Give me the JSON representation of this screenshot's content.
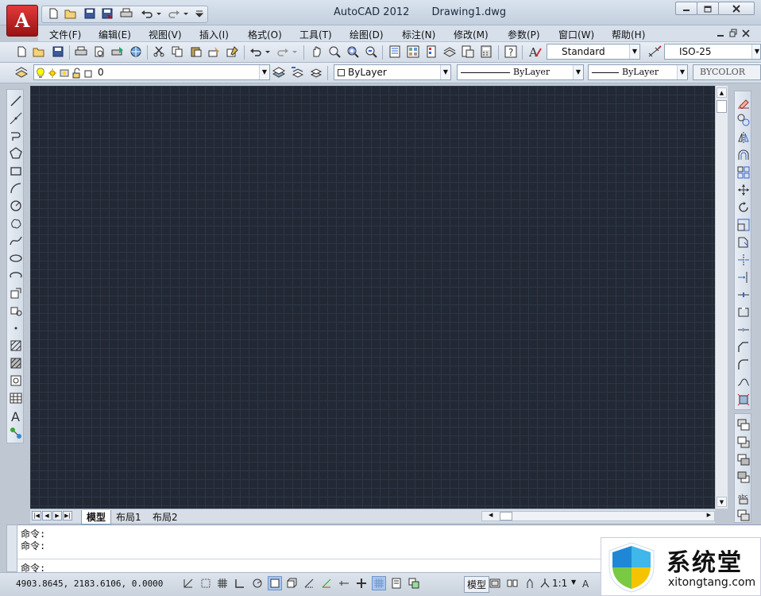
{
  "window": {
    "app_title": "AutoCAD 2012",
    "doc_title": "Drawing1.dwg",
    "app_button_letter": "A",
    "minimize_icon": "minimize-icon",
    "restore_icon": "restore-icon",
    "close_icon": "close-icon"
  },
  "menu": [
    "文件(F)",
    "编辑(E)",
    "视图(V)",
    "插入(I)",
    "格式(O)",
    "工具(T)",
    "绘图(D)",
    "标注(N)",
    "修改(M)",
    "参数(P)",
    "窗口(W)",
    "帮助(H)"
  ],
  "styles": {
    "text_style": "Standard",
    "dim_style": "ISO-25"
  },
  "layers": {
    "current_layer": "0",
    "color": "ByLayer",
    "linetype": "ByLayer",
    "lineweight": "ByLayer",
    "plotstyle": "BYCOLOR"
  },
  "tabs": {
    "model": "模型",
    "layout1": "布局1",
    "layout2": "布局2"
  },
  "command": {
    "line1": "命令:",
    "line2": "命令:",
    "prompt": "命令:"
  },
  "status": {
    "coords": "4903.8645, 2183.6106, 0.0000",
    "model_label": "模型",
    "scale": "1:1"
  },
  "watermark": {
    "brand_cn": "系统堂",
    "brand_url": "xitongtang.com"
  },
  "colors": {
    "canvas": "#222935",
    "grid": "#2d3645",
    "accent": "#c01818"
  }
}
